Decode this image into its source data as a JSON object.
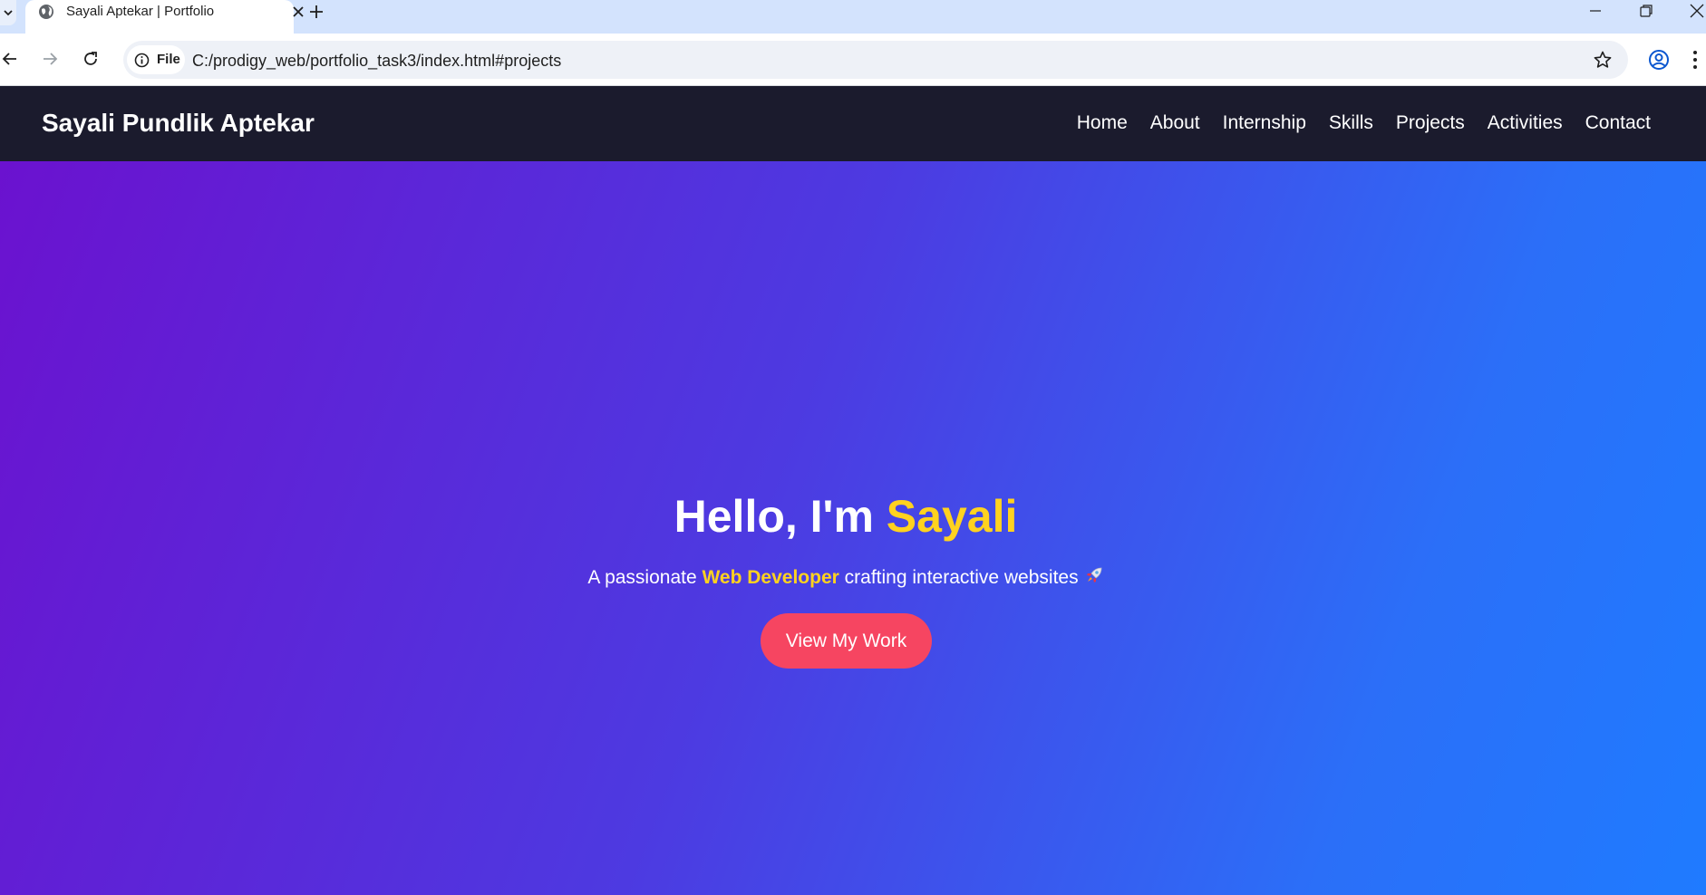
{
  "browser": {
    "tab_title": "Sayali Aptekar | Portfolio",
    "chip_label": "File",
    "url": "C:/prodigy_web/portfolio_task3/index.html#projects",
    "icons": [
      "tab-list-icon",
      "globe-icon",
      "close-icon",
      "plus-icon",
      "minimize-icon",
      "restore-icon",
      "window-close-icon",
      "back-arrow-icon",
      "forward-arrow-icon",
      "reload-icon",
      "info-icon",
      "star-icon",
      "profile-icon",
      "more-vert-icon"
    ]
  },
  "header": {
    "brand": "Sayali Pundlik Aptekar",
    "nav": [
      "Home",
      "About",
      "Internship",
      "Skills",
      "Projects",
      "Activities",
      "Contact"
    ]
  },
  "hero": {
    "title_prefix": "Hello, I'm ",
    "title_highlight": "Sayali",
    "sub_prefix": "A passionate ",
    "sub_highlight": "Web Developer",
    "sub_suffix": " crafting interactive websites",
    "sub_emoji": "rocket-icon",
    "cta_label": "View My Work"
  },
  "colors": {
    "header_bg": "#1b1b2d",
    "highlight": "#ffd21f",
    "cta_bg": "#f64561",
    "gradient_start": "#6b12cf",
    "gradient_end": "#1f7bff"
  }
}
